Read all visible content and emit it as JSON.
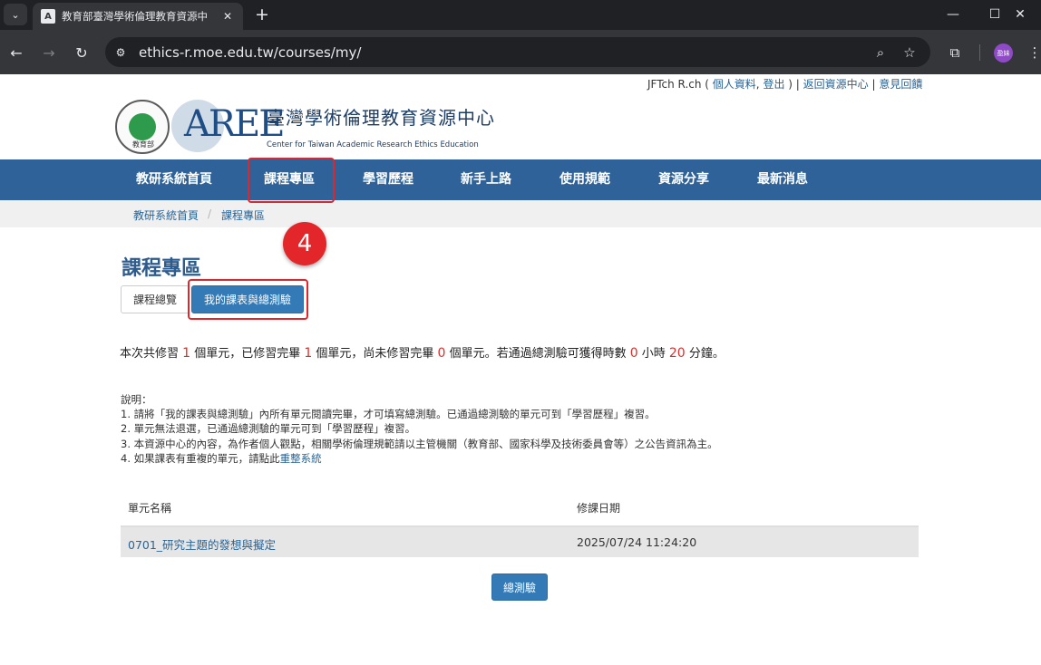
{
  "browser": {
    "tab_title": "教育部臺灣學術倫理教育資源中",
    "url": "ethics-r.moe.edu.tw/courses/my/",
    "profile_label": "盈妹"
  },
  "header": {
    "user_name": "JFTch R.ch",
    "paren_open": " ( ",
    "profile_link": "個人資料",
    "comma": ", ",
    "logout_link": "登出",
    "paren_close": " ) | ",
    "resource_center_link": "返回資源中心",
    "divider": " | ",
    "feedback_link": "意見回饋",
    "logo_mark": "AREE",
    "seal_text": "教育部",
    "center_name_zh": "臺灣學術倫理教育資源中心",
    "center_name_en": "Center for Taiwan Academic Research Ethics Education"
  },
  "nav": {
    "items": [
      "教研系統首頁",
      "課程專區",
      "學習歷程",
      "新手上路",
      "使用規範",
      "資源分享",
      "最新消息"
    ]
  },
  "breadcrumb": {
    "home": "教研系統首頁",
    "separator": "/",
    "current": "課程專區"
  },
  "annotation": {
    "step_number": "4",
    "color": "#e0262a"
  },
  "page": {
    "title": "課程專區",
    "tab_overview": "課程總覽",
    "tab_my_courses": "我的課表與總測驗"
  },
  "summary": {
    "t1": "本次共修習 ",
    "total_units": "1",
    "t2": " 個單元，已修習完畢 ",
    "completed_units": "1",
    "t3": " 個單元，尚未修習完畢 ",
    "remaining_units": "0",
    "t4": " 個單元。若通過總測驗可獲得時數 ",
    "hours": "0",
    "t5": " 小時 ",
    "minutes": "20",
    "t6": " 分鐘。"
  },
  "notes": {
    "heading": "說明：",
    "line1": "1. 請將「我的課表與總測驗」內所有單元閱讀完畢，才可填寫總測驗。已通過總測驗的單元可到「學習歷程」複習。",
    "line2": "2. 單元無法退選，已通過總測驗的單元可到「學習歷程」複習。",
    "line3": "3. 本資源中心的內容，為作者個人觀點，相關學術倫理規範請以主管機關（教育部、國家科學及技術委員會等）之公告資訊為主。",
    "line4_prefix": "4. 如果課表有重複的單元，請點此",
    "line4_link": "重整系統"
  },
  "table": {
    "col_unit": "單元名稱",
    "col_date": "修課日期",
    "rows": [
      {
        "unit": "0701_研究主題的發想與擬定",
        "date": "2025/07/24 11:24:20"
      }
    ]
  },
  "exam_button": "總測驗",
  "colors": {
    "nav_bg": "#2e6299",
    "primary": "#337ab7",
    "highlight_red": "#d9302c"
  }
}
